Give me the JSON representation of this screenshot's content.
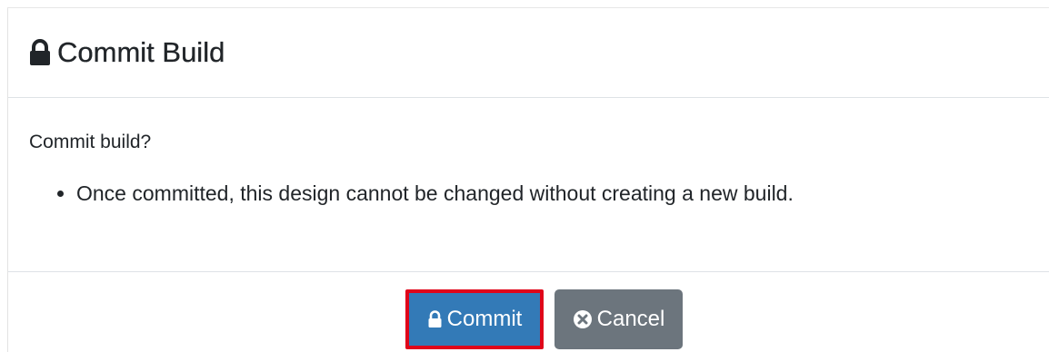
{
  "modal": {
    "title": "Commit Build",
    "title_icon": "lock-icon",
    "question": "Commit build?",
    "notes": [
      "Once committed, this design cannot be changed without creating a new build."
    ]
  },
  "footer": {
    "commit_label": "Commit",
    "commit_icon": "lock-icon",
    "cancel_label": "Cancel",
    "cancel_icon": "times-circle-icon"
  },
  "colors": {
    "primary": "#337ab7",
    "secondary": "#6c757d",
    "highlight": "#e0051a"
  }
}
